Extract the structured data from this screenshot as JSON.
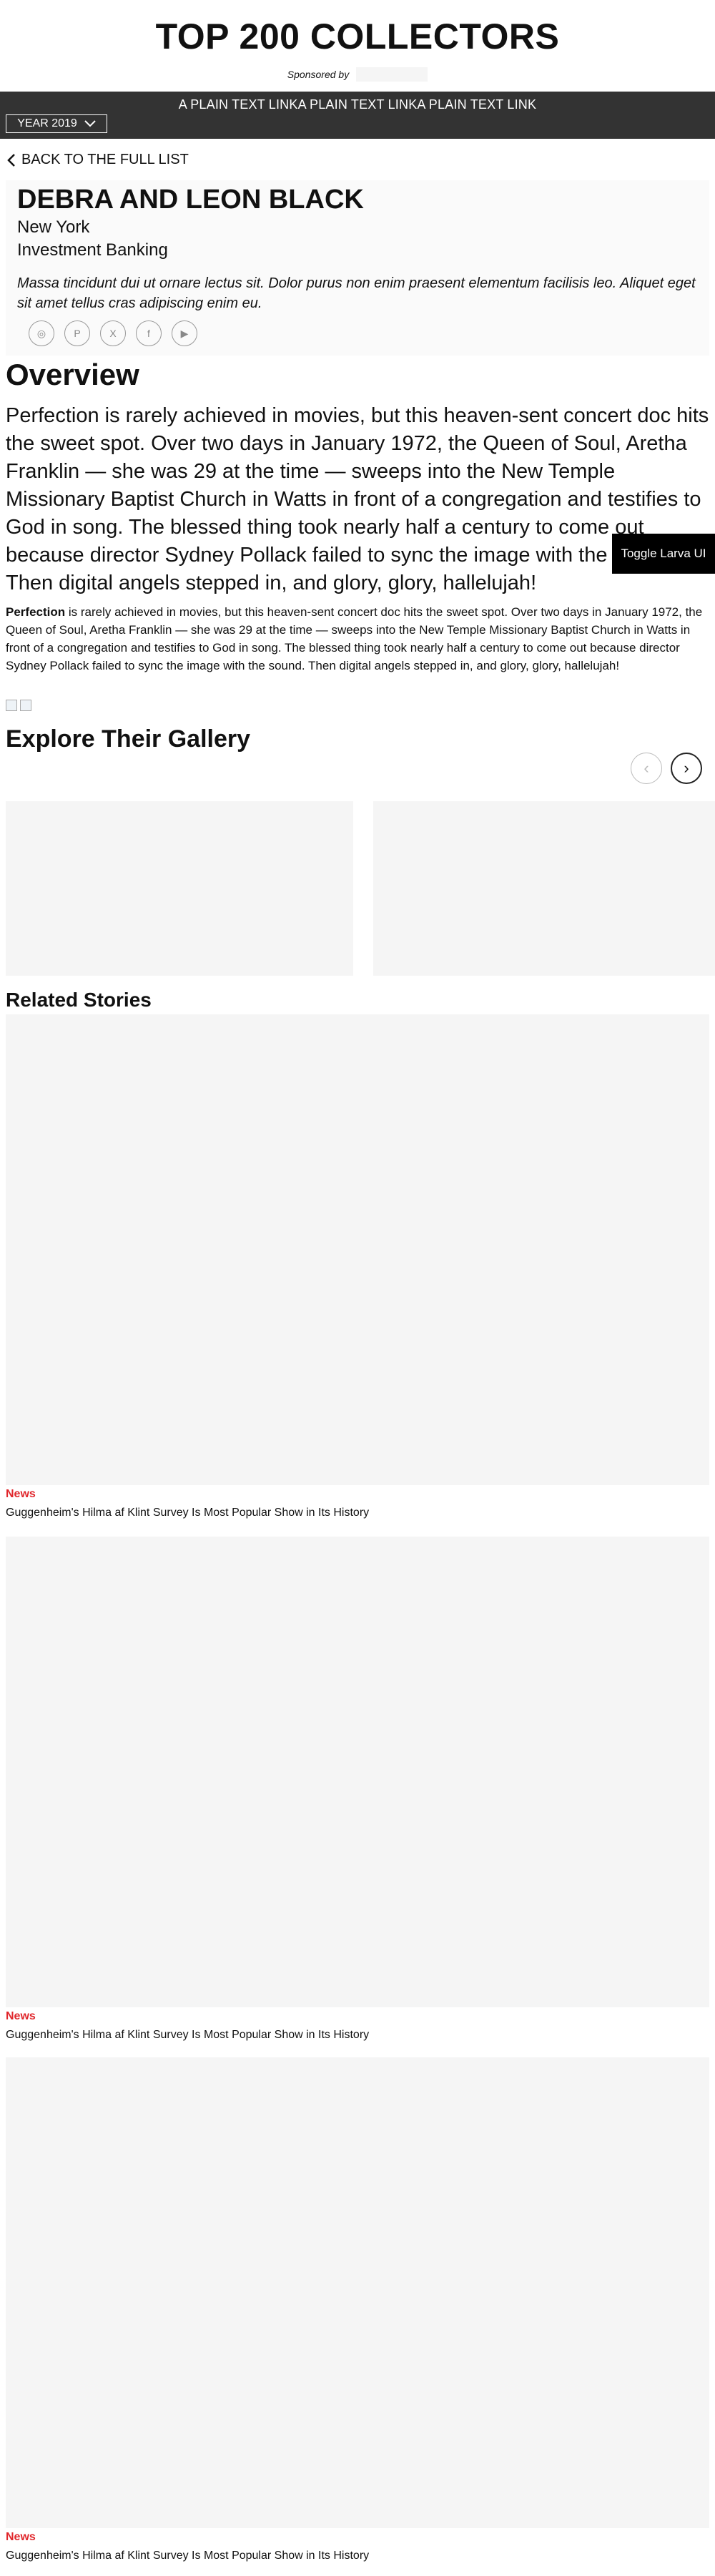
{
  "masthead": {
    "title": "TOP 200 COLLECTORS",
    "sponsored_by": "Sponsored by"
  },
  "nav": {
    "links": "A PLAIN TEXT LINKA PLAIN TEXT LINKA PLAIN TEXT LINK",
    "year_label": "YEAR 2019"
  },
  "back_link": "BACK TO THE FULL LIST",
  "profile": {
    "name": "DEBRA AND LEON BLACK",
    "location": "New York",
    "industry": "Investment Banking",
    "bio": "Massa tincidunt dui ut ornare lectus sit. Dolor purus non enim praesent elementum facilisis leo. Aliquet eget sit amet tellus cras adipiscing enim eu.",
    "social": [
      {
        "icon": "instagram-icon",
        "glyph": "◎"
      },
      {
        "icon": "pinterest-icon",
        "glyph": "P"
      },
      {
        "icon": "x-icon",
        "glyph": "X"
      },
      {
        "icon": "facebook-icon",
        "glyph": "f"
      },
      {
        "icon": "youtube-icon",
        "glyph": "▶"
      }
    ]
  },
  "overview": {
    "title": "Overview",
    "lead": "Perfection is rarely achieved in movies, but this heaven-sent concert doc hits the sweet spot. Over two days in January 1972, the Queen of Soul, Aretha Franklin — she was 29 at the time — sweeps into the New Temple Missionary Baptist Church in Watts in front of a congregation and testifies to God in song. The blessed thing took nearly half a century to come out because director Sydney Pollack failed to sync the image with the sound. Then digital angels stepped in, and glory, glory, hallelujah!",
    "body_bold": "Perfection",
    "body_rest": " is rarely achieved in movies, but this heaven-sent concert doc hits the sweet spot. Over two days in January 1972, the Queen of Soul, Aretha Franklin — she was 29 at the time — sweeps into the New Temple Missionary Baptist Church in Watts in front of a congregation and testifies to God in song. The blessed thing took nearly half a century to come out because director Sydney Pollack failed to sync the image with the sound. Then digital angels stepped in, and glory, glory, hallelujah!"
  },
  "toggle_label": "Toggle Larva UI",
  "gallery": {
    "title": "Explore Their Gallery",
    "prev_glyph": "‹",
    "next_glyph": "›"
  },
  "related": {
    "title": "Related Stories",
    "stories": [
      {
        "category": "News",
        "title": "Guggenheim's Hilma af Klint Survey Is Most Popular Show in Its History"
      },
      {
        "category": "News",
        "title": "Guggenheim's Hilma af Klint Survey Is Most Popular Show in Its History"
      },
      {
        "category": "News",
        "title": "Guggenheim's Hilma af Klint Survey Is Most Popular Show in Its History"
      }
    ]
  },
  "colors": {
    "nav_bg": "#333333",
    "category_red": "#e0262b",
    "placeholder_gray": "#f5f5f5"
  }
}
